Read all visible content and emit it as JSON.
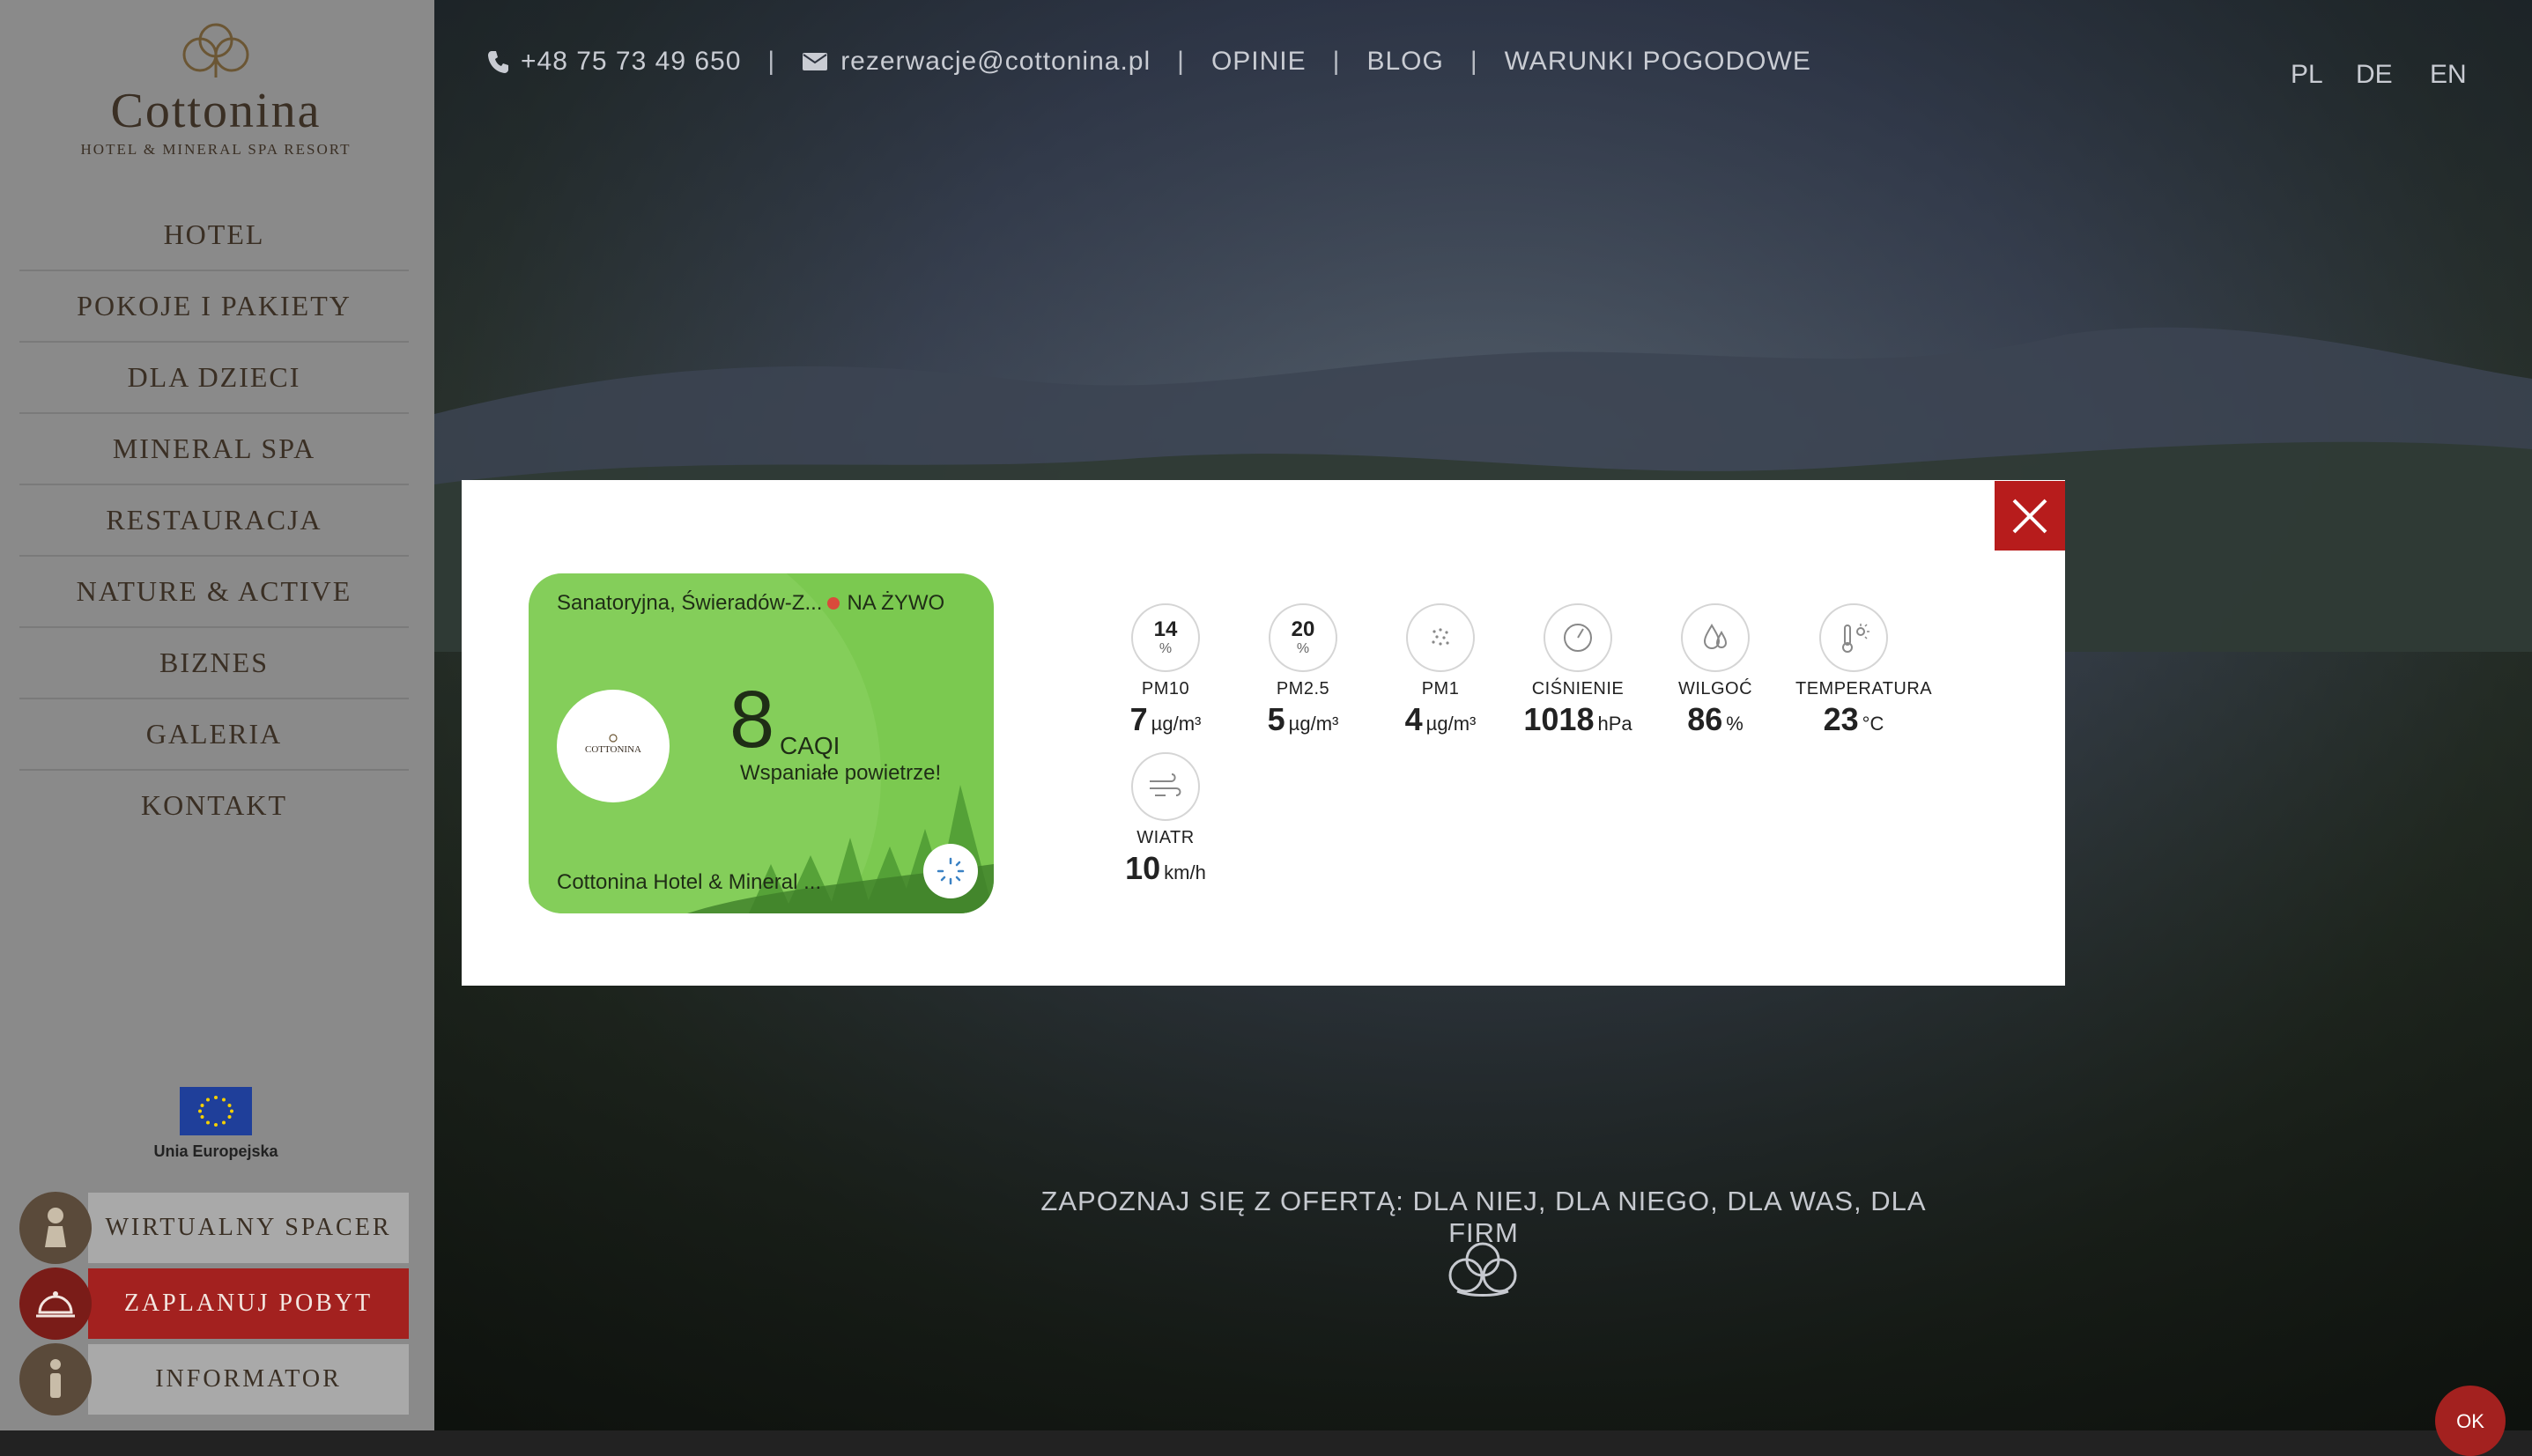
{
  "brand": {
    "name": "Cottonina",
    "subtitle": "HOTEL & MINERAL SPA RESORT"
  },
  "nav": {
    "items": [
      {
        "label": "HOTEL"
      },
      {
        "label": "POKOJE I PAKIETY"
      },
      {
        "label": "DLA DZIECI"
      },
      {
        "label": "MINERAL SPA"
      },
      {
        "label": "RESTAURACJA"
      },
      {
        "label": "NATURE & ACTIVE"
      },
      {
        "label": "BIZNES"
      },
      {
        "label": "GALERIA"
      },
      {
        "label": "KONTAKT"
      }
    ]
  },
  "eu": {
    "label": "Unia Europejska"
  },
  "side_buttons": {
    "virtual_tour": "WIRTUALNY SPACER",
    "plan_stay": "ZAPLANUJ POBYT",
    "info": "INFORMATOR"
  },
  "topbar": {
    "phone": "+48 75 73 49 650",
    "email": "rezerwacje@cottonina.pl",
    "links": [
      "OPINIE",
      "BLOG",
      "WARUNKI POGODOWE"
    ]
  },
  "languages": [
    "PL",
    "DE",
    "EN"
  ],
  "tagline": "ZAPOZNAJ SIĘ Z OFERTĄ: DLA NIEJ, DLA NIEGO, DLA WAS, DLA FIRM",
  "cookie_ok": "OK",
  "widget": {
    "location": "Sanatoryjna, Świeradów-Z...",
    "live": "NA ŻYWO",
    "caqi_value": "8",
    "caqi_unit": "CAQI",
    "caqi_desc": "Wspaniałe powietrze!",
    "footer": "Cottonina Hotel & Mineral ...",
    "card_color": "#7bc950"
  },
  "metrics": [
    {
      "name": "PM10",
      "ring_value": "14",
      "ring_unit": "%",
      "value": "7",
      "unit": "µg/m³"
    },
    {
      "name": "PM2.5",
      "ring_value": "20",
      "ring_unit": "%",
      "value": "5",
      "unit": "µg/m³"
    },
    {
      "name": "PM1",
      "value": "4",
      "unit": "µg/m³"
    },
    {
      "name": "CIŚNIENIE",
      "value": "1018",
      "unit": "hPa"
    },
    {
      "name": "WILGOĆ",
      "value": "86",
      "unit": "%"
    },
    {
      "name": "TEMPERATURA",
      "value": "23",
      "unit": "°C"
    },
    {
      "name": "WIATR",
      "value": "10",
      "unit": "km/h"
    }
  ],
  "colors": {
    "accent_red": "#b71c1c",
    "sidebar_bg": "#8a8a8a",
    "brand_brown": "#3a2f24"
  }
}
